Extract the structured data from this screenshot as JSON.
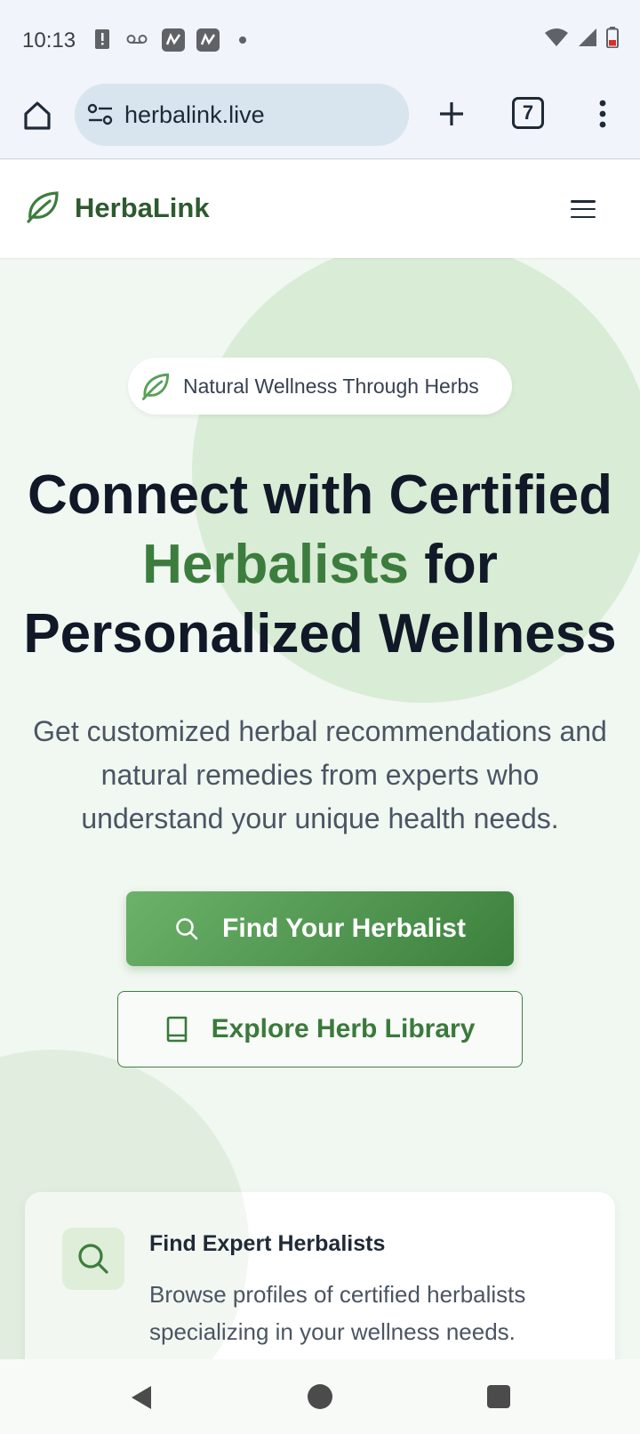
{
  "status_bar": {
    "time": "10:13",
    "icons_left": [
      "alert-icon",
      "voicemail-icon",
      "app-notification-icon",
      "app-notification-icon",
      "dot-icon"
    ],
    "icons_right": [
      "wifi-icon",
      "signal-icon",
      "battery-low-icon"
    ]
  },
  "browser": {
    "url": "herbalink.live",
    "tab_count": "7"
  },
  "header": {
    "brand": "HerbaLink"
  },
  "hero": {
    "badge": "Natural Wellness Through Herbs",
    "headline_line1": "Connect with Certified",
    "headline_accent": "Herbalists",
    "headline_for": " for",
    "headline_line3": "Personalized Wellness",
    "subtext": "Get customized herbal recommendations and natural remedies from experts who understand your unique health needs.",
    "primary_button": "Find Your Herbalist",
    "secondary_button": "Explore Herb Library"
  },
  "feature_card": {
    "title": "Find Expert Herbalists",
    "description": "Browse profiles of certified herbalists specializing in your wellness needs."
  },
  "colors": {
    "brand_green": "#3c7d3d",
    "brand_dark": "#2e5a2f",
    "hero_bg": "#f1f7f1",
    "blob": "#d9ecd6"
  }
}
